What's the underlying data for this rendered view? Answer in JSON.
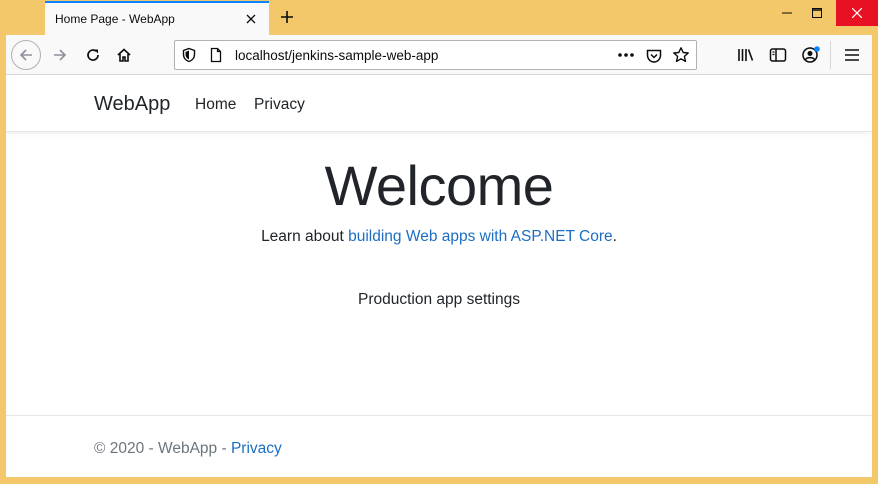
{
  "browser": {
    "tab_title": "Home Page - WebApp",
    "url": "localhost/jenkins-sample-web-app",
    "accent_color": "#0a84ff",
    "frame_color": "#f3c86b"
  },
  "site": {
    "brand": "WebApp",
    "nav": {
      "home": "Home",
      "privacy": "Privacy"
    },
    "hero_title": "Welcome",
    "learn_prefix": "Learn about ",
    "learn_link": "building Web apps with ASP.NET Core",
    "learn_suffix": ".",
    "settings_text": "Production app settings",
    "footer": {
      "copyright": "© 2020 - WebApp - ",
      "privacy_link": "Privacy"
    },
    "link_color": "#1b6ec2"
  }
}
